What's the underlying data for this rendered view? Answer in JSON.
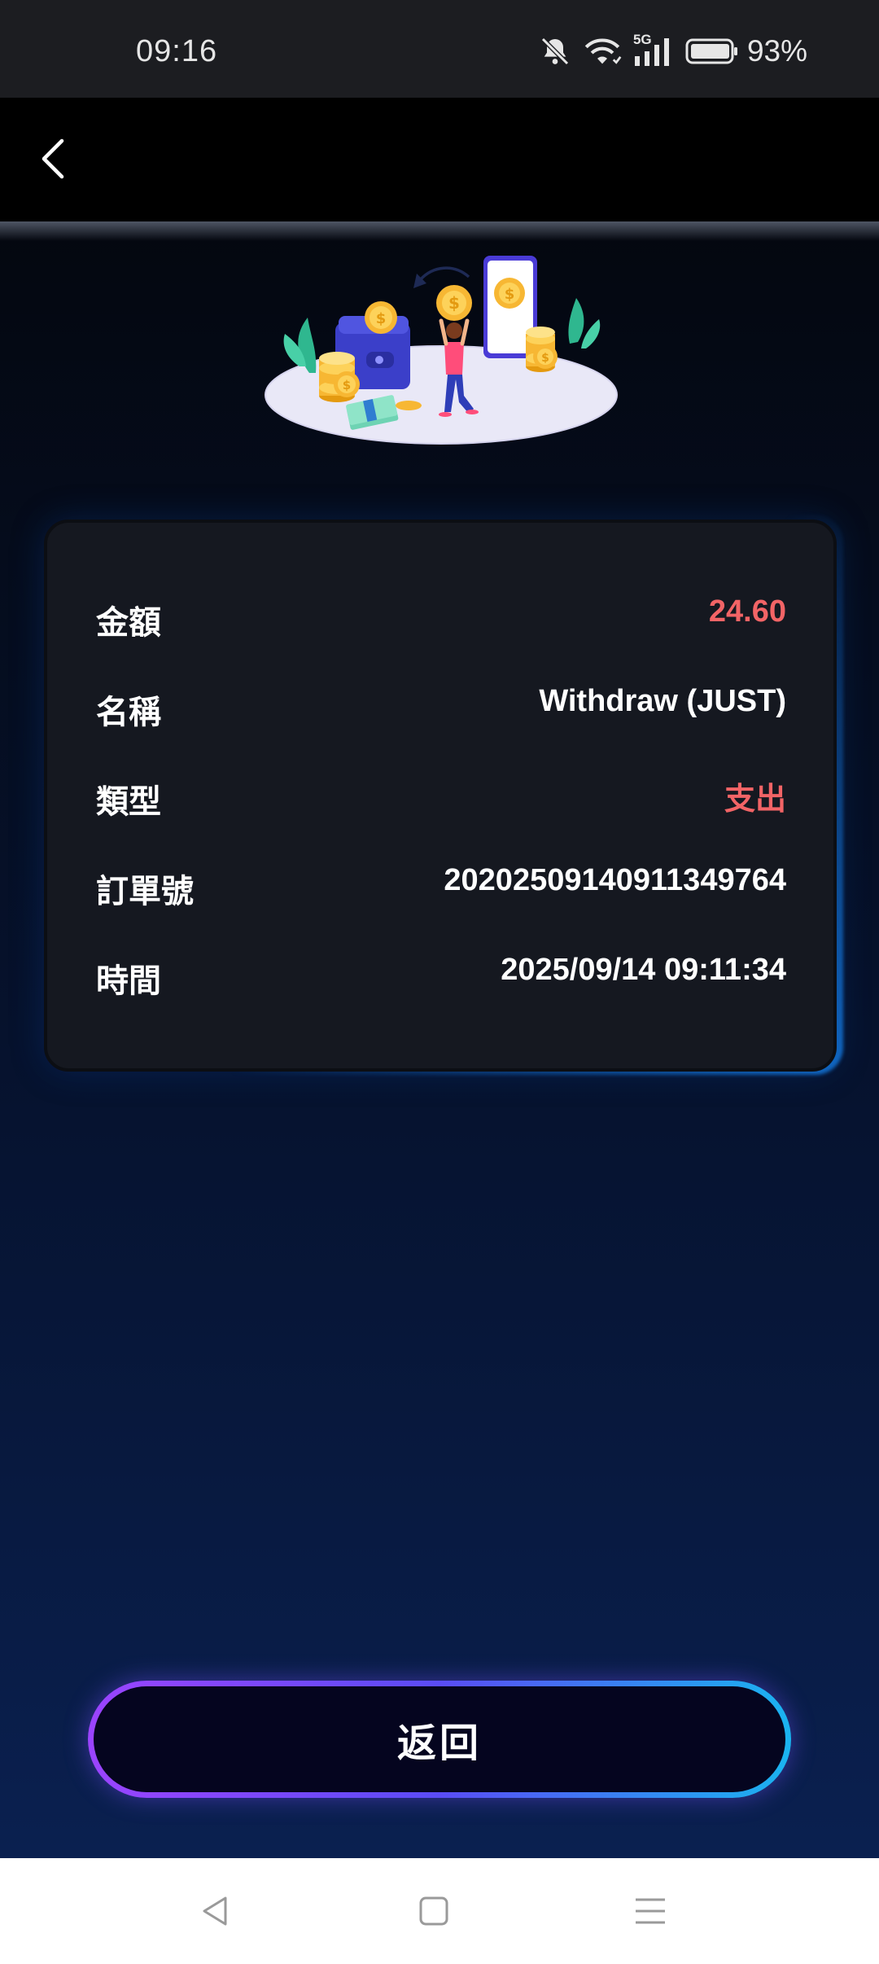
{
  "status_bar": {
    "time": "09:16",
    "network": "5G",
    "battery": "93%"
  },
  "header": {
    "back_icon": "chevron-left-icon"
  },
  "illustration": {
    "currency_symbol": "$"
  },
  "details": {
    "amount_label": "金額",
    "amount_value": "24.60",
    "name_label": "名稱",
    "name_value": "Withdraw (JUST)",
    "type_label": "類型",
    "type_value": "支出",
    "order_label": "訂單號",
    "order_value": "20202509140911349764",
    "time_label": "時間",
    "time_value": "2025/09/14 09:11:34"
  },
  "footer": {
    "return_label": "返回"
  },
  "colors": {
    "accent_red": "#f26466",
    "card_bg": "#151820",
    "button_gradient_start": "#9b44ff",
    "button_gradient_end": "#1ab4f0"
  }
}
